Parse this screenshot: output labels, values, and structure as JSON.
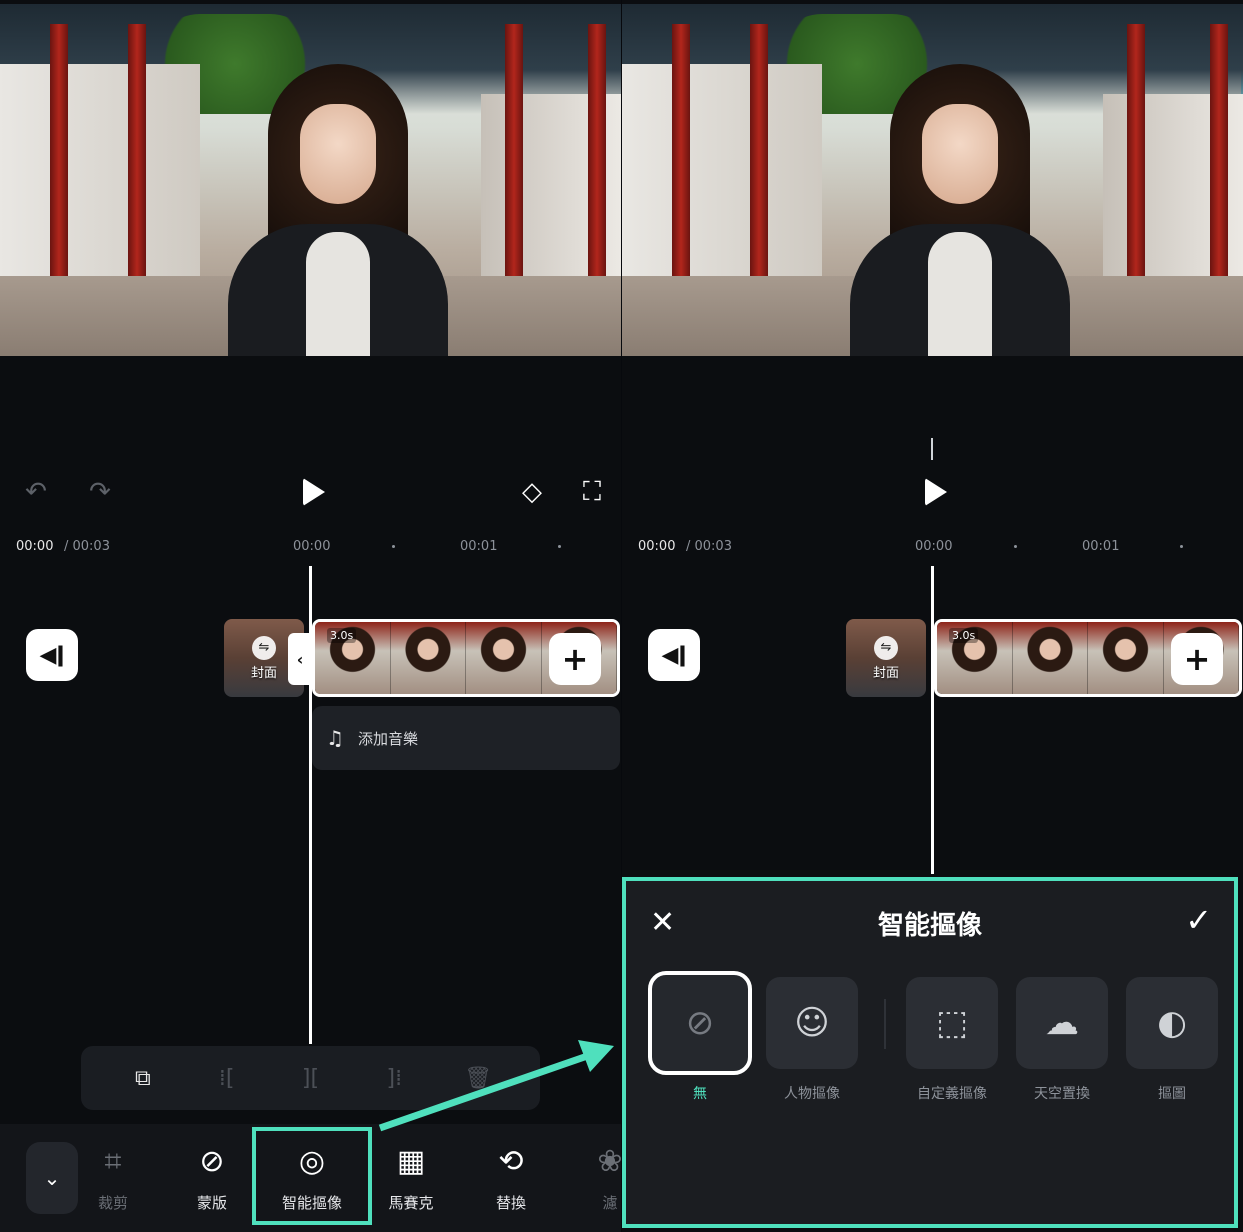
{
  "timeline": {
    "current_time": "00:00",
    "total_time": "/ 00:03",
    "marker_0": "00:00",
    "marker_1": "00:01",
    "clip_duration": "3.0s",
    "cover_label": "封面",
    "add_music_label": "添加音樂"
  },
  "toolbar": {
    "items": [
      {
        "label": "裁剪",
        "icon": "crop-icon"
      },
      {
        "label": "蒙版",
        "icon": "mask-icon"
      },
      {
        "label": "智能摳像",
        "icon": "smart-cutout-icon"
      },
      {
        "label": "馬賽克",
        "icon": "mosaic-icon"
      },
      {
        "label": "替換",
        "icon": "replace-icon"
      },
      {
        "label": "濾",
        "icon": "filter-icon"
      }
    ]
  },
  "smart_cutout_panel": {
    "title": "智能摳像",
    "options": [
      {
        "label": "無",
        "icon": "none-icon",
        "selected": true
      },
      {
        "label": "人物摳像",
        "icon": "portrait-cutout-icon",
        "selected": false
      },
      {
        "label": "自定義摳像",
        "icon": "custom-cutout-icon",
        "selected": false
      },
      {
        "label": "天空置換",
        "icon": "sky-replace-icon",
        "selected": false
      },
      {
        "label": "摳圖",
        "icon": "cutout-icon",
        "selected": false
      }
    ]
  },
  "colors": {
    "highlight": "#4fe0bd",
    "background": "#0b0d10",
    "preview_outline": "#7fd6e6"
  }
}
